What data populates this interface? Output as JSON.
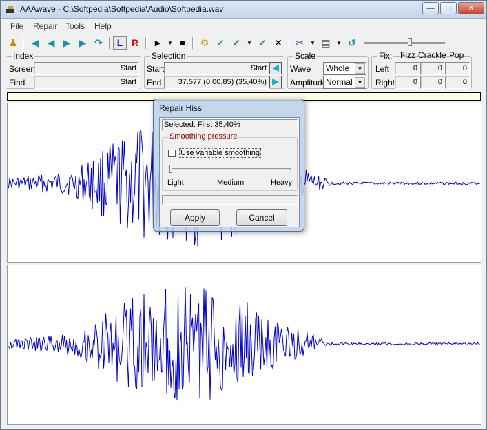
{
  "window": {
    "title": "AAAwave - C:\\Softpedia\\Softpedia\\Audio\\Softpedia.wav",
    "minimize": "—",
    "maximize": "□",
    "close": "✕"
  },
  "menu": [
    "File",
    "Repair",
    "Tools",
    "Help"
  ],
  "toolbar": {
    "icons": [
      "person-icon",
      "skip-start-icon",
      "step-back-icon",
      "step-forward-icon",
      "skip-end-icon",
      "loop-icon",
      "channel-left-icon",
      "channel-right-icon",
      "play-icon",
      "dropdown-icon",
      "stop-icon",
      "select-icon",
      "check-blue-icon",
      "check-green-icon",
      "dropdown-icon",
      "check-green-icon",
      "close-icon",
      "cut-icon",
      "dropdown-icon",
      "paste-icon",
      "dropdown-icon",
      "undo-icon",
      "volume-slider"
    ],
    "left_label": "L",
    "right_label": "R"
  },
  "index": {
    "title": "Index",
    "screen_label": "Screen",
    "screen_value": "Start",
    "find_label": "Find",
    "find_value": "Start"
  },
  "selection": {
    "title": "Selection",
    "start_label": "Start",
    "start_value": "Start",
    "end_label": "End",
    "end_value": "37.577  (0:00,85)  (35,40%)"
  },
  "scale": {
    "title": "Scale",
    "wave_label": "Wave",
    "wave_value": "Whole",
    "amplitude_label": "Amplitude",
    "amplitude_value": "Normal"
  },
  "fix": {
    "title": "Fix:",
    "fizz": "Fizz",
    "crackle": "Crackle",
    "pop": "Pop",
    "left_label": "Left",
    "right_label": "Right",
    "left_values": [
      "0",
      "0",
      "0"
    ],
    "right_values": [
      "0",
      "0",
      "0"
    ]
  },
  "dialog": {
    "title": "Repair Hiss",
    "selected": "Selected: First 35,40%",
    "group_title": "Smoothing pressure",
    "checkbox_label": "Use variable smoothing",
    "slider_labels": [
      "Light",
      "Medium",
      "Heavy"
    ],
    "apply": "Apply",
    "cancel": "Cancel"
  },
  "colors": {
    "waveform": "#0000cc",
    "titlebar": "#c5d6ec",
    "selection_bar": "#fffde0"
  }
}
